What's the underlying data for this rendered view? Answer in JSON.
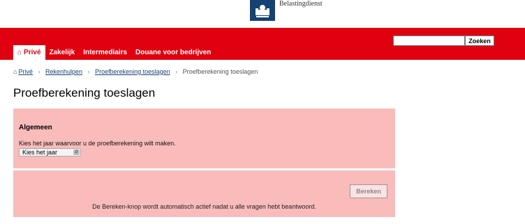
{
  "header": {
    "logo_text": "Belastingdienst"
  },
  "nav": {
    "tabs": [
      {
        "label": "Privé",
        "active": true
      },
      {
        "label": "Zakelijk",
        "active": false
      },
      {
        "label": "Intermediairs",
        "active": false
      },
      {
        "label": "Douane voor bedrijven",
        "active": false
      }
    ],
    "search": {
      "value": "",
      "button_label": "Zoeken"
    }
  },
  "breadcrumb": {
    "items": [
      "Privé",
      "Rekenhulpen",
      "Proefberekening toeslagen"
    ],
    "current": "Proefberekening toeslagen"
  },
  "page": {
    "title": "Proefberekening toeslagen"
  },
  "form": {
    "section_title": "Algemeen",
    "year_label": "Kies het jaar waarvoor u de proefberekening wilt maken.",
    "year_select_value": "Kies het jaar",
    "calculate_label": "Bereken",
    "note": "De Bereken-knop wordt automatisch actief nadat u alle vragen hebt beantwoord."
  },
  "colors": {
    "brand_red": "#e1000f",
    "panel_pink": "#fabbbb",
    "logo_blue": "#154273"
  },
  "icons": {
    "home": "home-icon",
    "logo": "crest-logo-icon",
    "breadcrumb_separator": "chevron-right-icon",
    "select_arrow": "updown-chevron-icon"
  }
}
